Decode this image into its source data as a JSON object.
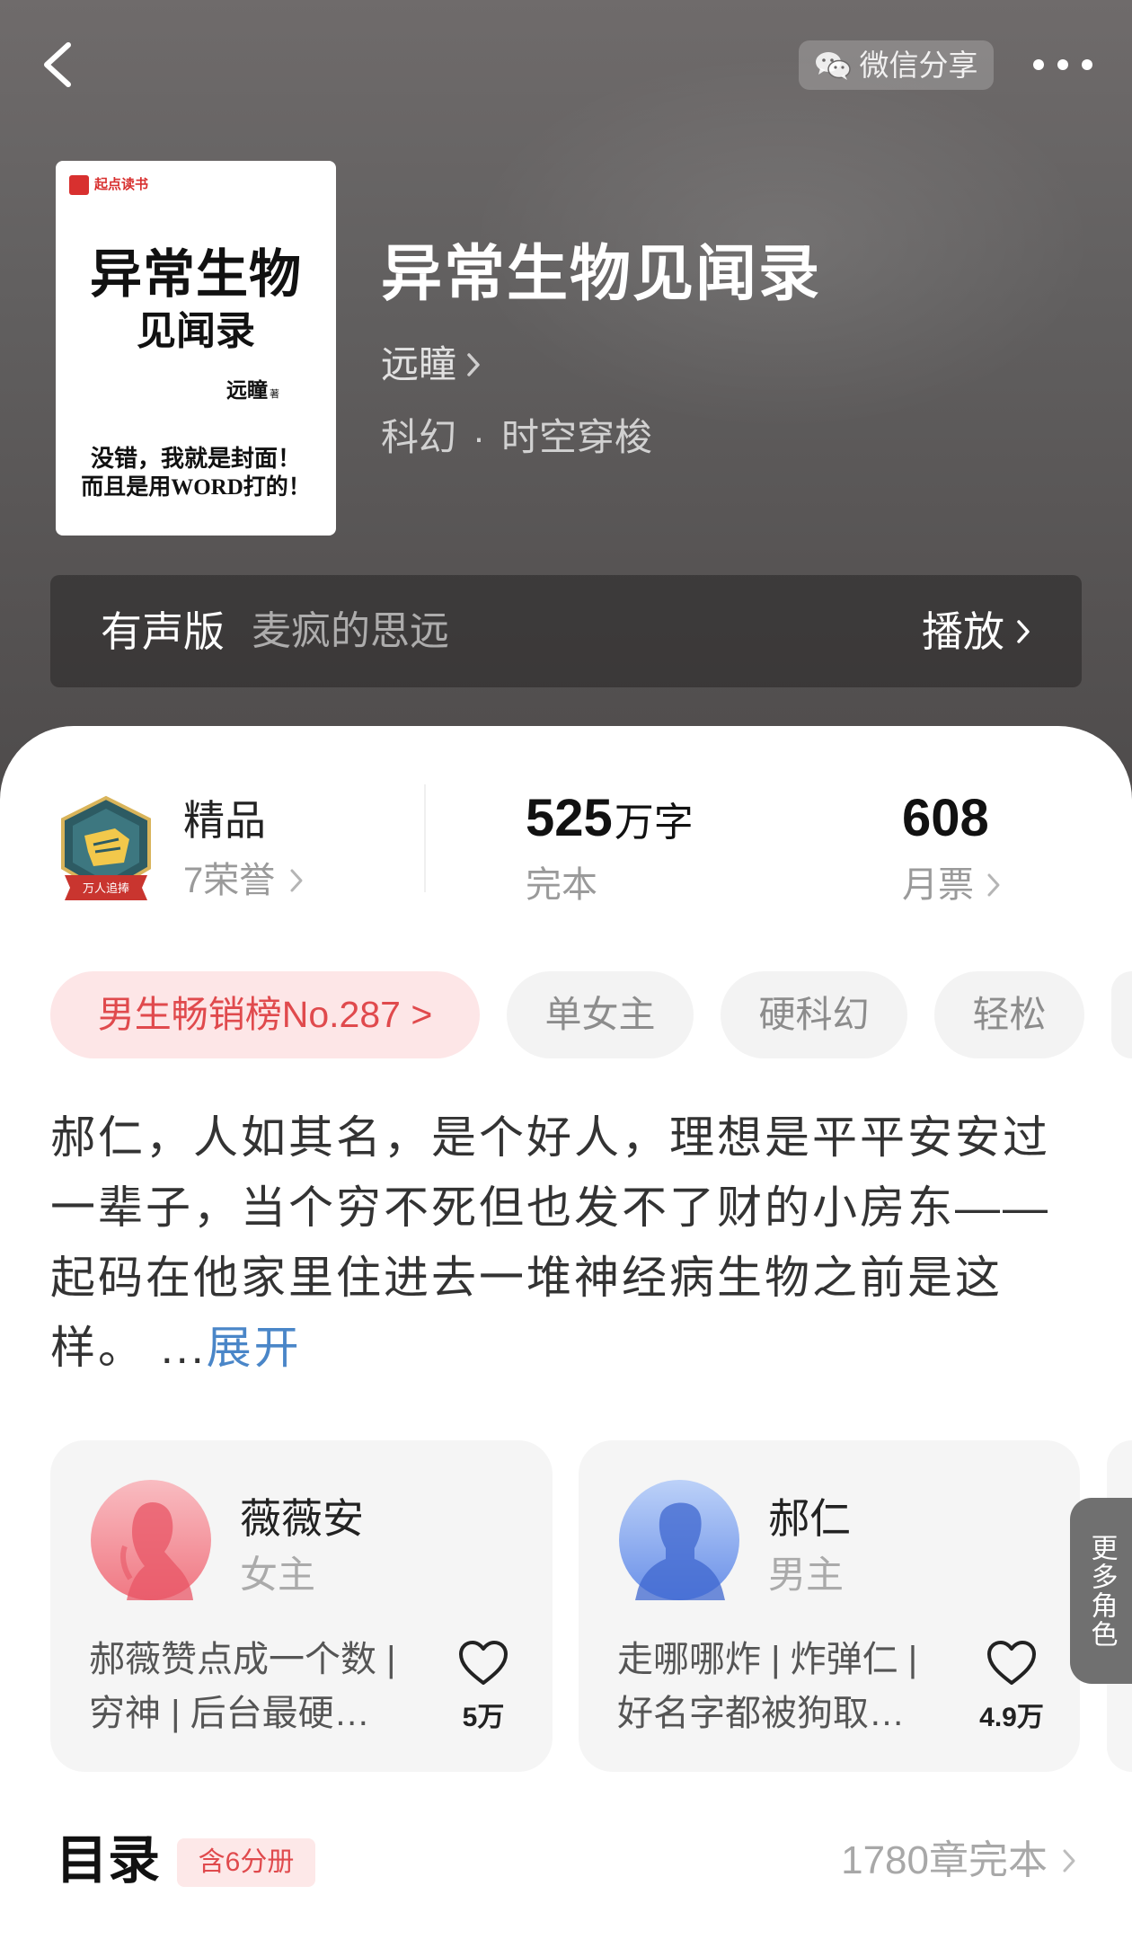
{
  "header": {
    "share_label": "微信分享",
    "icons": {
      "back": "chevron-left-icon",
      "share": "wechat-icon",
      "more": "more-dots-icon"
    }
  },
  "book": {
    "title": "异常生物见闻录",
    "author": "远瞳",
    "genre": "科幻",
    "separator": "·",
    "subgenre": "时空穿梭",
    "cover": {
      "brand": "起点读书",
      "title_line1": "异常生物",
      "title_line2": "见闻录",
      "author": "远瞳",
      "author_suffix": "著",
      "slogan_line1": "没错，我就是封面！",
      "slogan_line2": "而且是用WORD打的！"
    }
  },
  "audio": {
    "label": "有声版",
    "narrator": "麦疯的思远",
    "play_label": "播放"
  },
  "stats": {
    "honor": {
      "label": "精品",
      "count": "7荣誉",
      "badge_text": "万人追捧"
    },
    "words": {
      "value": "525",
      "unit": "万字",
      "status": "完本"
    },
    "tickets": {
      "value": "608",
      "label": "月票"
    }
  },
  "tags": [
    {
      "label": "男生畅销榜No.287 >"
    },
    {
      "label": "单女主"
    },
    {
      "label": "硬科幻"
    },
    {
      "label": "轻松"
    }
  ],
  "description": {
    "lines": [
      "郝仁，人如其名，是个好人，理想是平平安安过",
      "一辈子，当个穷不死但也发不了财的小房东——",
      "起码在他家里住进去一堆神经病生物之前是这",
      "样。"
    ],
    "ellipsis": "...",
    "expand_label": "展开"
  },
  "characters": [
    {
      "name": "薇薇安",
      "role": "女主",
      "desc_line1": "郝薇赞点成一个数 |",
      "desc_line2": "穷神 | 后台最硬…",
      "likes": "5万"
    },
    {
      "name": "郝仁",
      "role": "男主",
      "desc_line1": "走哪哪炸 | 炸弹仁 |",
      "desc_line2": "好名字都被狗取…",
      "likes": "4.9万"
    }
  ],
  "more_roles_label": "更多角色",
  "catalog": {
    "title": "目录",
    "volumes": "含6分册",
    "chapters": "1780章完本"
  },
  "colors": {
    "accent_red": "#e04a4d",
    "tag_pink_bg": "#fde6e7",
    "link_blue": "#4a86c8",
    "hero_bg": "#5e5b5b"
  }
}
